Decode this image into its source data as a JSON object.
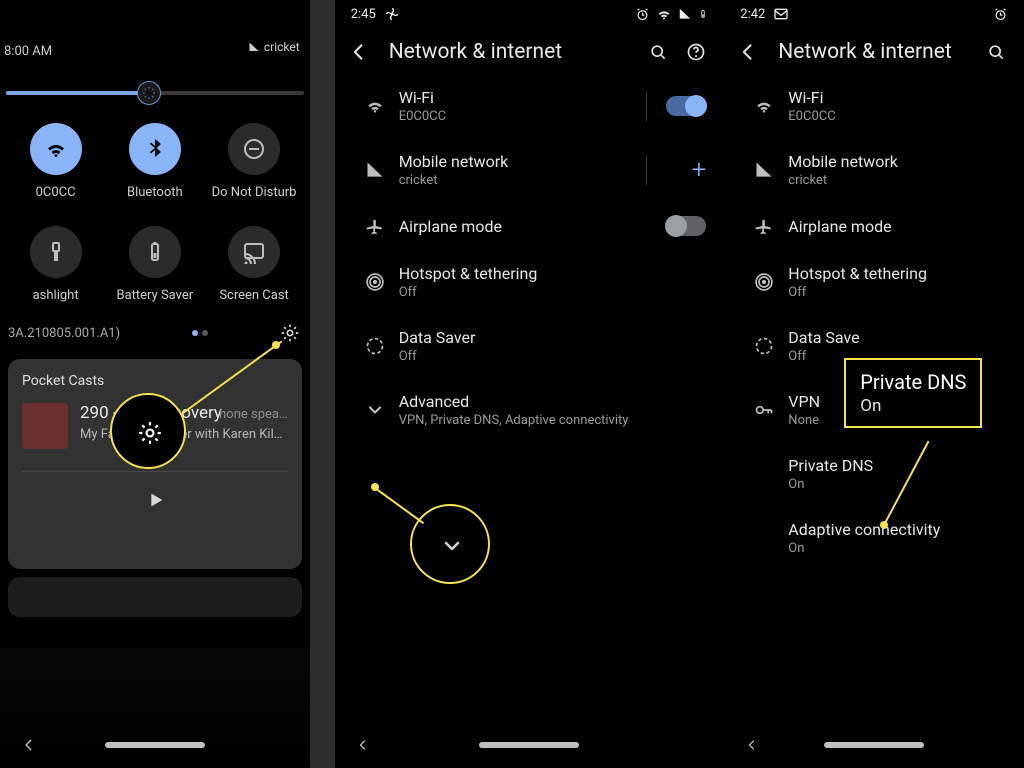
{
  "panel1": {
    "time": "8:00 AM",
    "carrier": "cricket",
    "slider_pct": 48,
    "tiles": [
      {
        "label": "0C0CC",
        "icon": "wifi-icon",
        "state": "on"
      },
      {
        "label": "Bluetooth",
        "icon": "bluetooth-icon",
        "state": "on"
      },
      {
        "label": "Do Not Disturb",
        "icon": "dnd-icon",
        "state": "off"
      },
      {
        "label": "ashlight",
        "icon": "flashlight-icon",
        "state": "off"
      },
      {
        "label": "Battery Saver",
        "icon": "battery-icon",
        "state": "off"
      },
      {
        "label": "Screen Cast",
        "icon": "cast-icon",
        "state": "off"
      }
    ],
    "build": "3A.210805.001.A1)",
    "media": {
      "app": "Pocket Casts",
      "title": "290 - Full          Recovery",
      "subtitle": "My Favorite Murder with Karen Kil…",
      "device": "hone spea…"
    }
  },
  "panel2": {
    "time": "2:45",
    "title": "Network & internet",
    "items": [
      {
        "icon": "wifi-icon",
        "t1": "Wi-Fi",
        "t2": "E0C0CC",
        "ctrl": "switch-on"
      },
      {
        "icon": "signal-icon",
        "t1": "Mobile network",
        "t2": "cricket",
        "ctrl": "plus"
      },
      {
        "icon": "airplane-icon",
        "t1": "Airplane mode",
        "t2": "",
        "ctrl": "switch-off"
      },
      {
        "icon": "hotspot-icon",
        "t1": "Hotspot & tethering",
        "t2": "Off",
        "ctrl": ""
      },
      {
        "icon": "datasaver-icon",
        "t1": "Data Saver",
        "t2": "Off",
        "ctrl": ""
      },
      {
        "icon": "chevron-down-icon",
        "t1": "Advanced",
        "t2": "VPN, Private DNS, Adaptive connectivity",
        "ctrl": ""
      }
    ]
  },
  "panel3": {
    "time": "2:42",
    "title": "Network & internet",
    "items": [
      {
        "icon": "wifi-icon",
        "t1": "Wi-Fi",
        "t2": "E0C0CC"
      },
      {
        "icon": "signal-icon",
        "t1": "Mobile network",
        "t2": "cricket"
      },
      {
        "icon": "airplane-icon",
        "t1": "Airplane mode",
        "t2": ""
      },
      {
        "icon": "hotspot-icon",
        "t1": "Hotspot & tethering",
        "t2": "Off"
      },
      {
        "icon": "datasaver-icon",
        "t1": "Data Save",
        "t2": "Off"
      },
      {
        "icon": "vpn-icon",
        "t1": "VPN",
        "t2": "None"
      },
      {
        "icon": "",
        "t1": "Private DNS",
        "t2": "On"
      },
      {
        "icon": "",
        "t1": "Adaptive connectivity",
        "t2": "On"
      }
    ],
    "callout": {
      "t1": "Private DNS",
      "t2": "On"
    }
  }
}
